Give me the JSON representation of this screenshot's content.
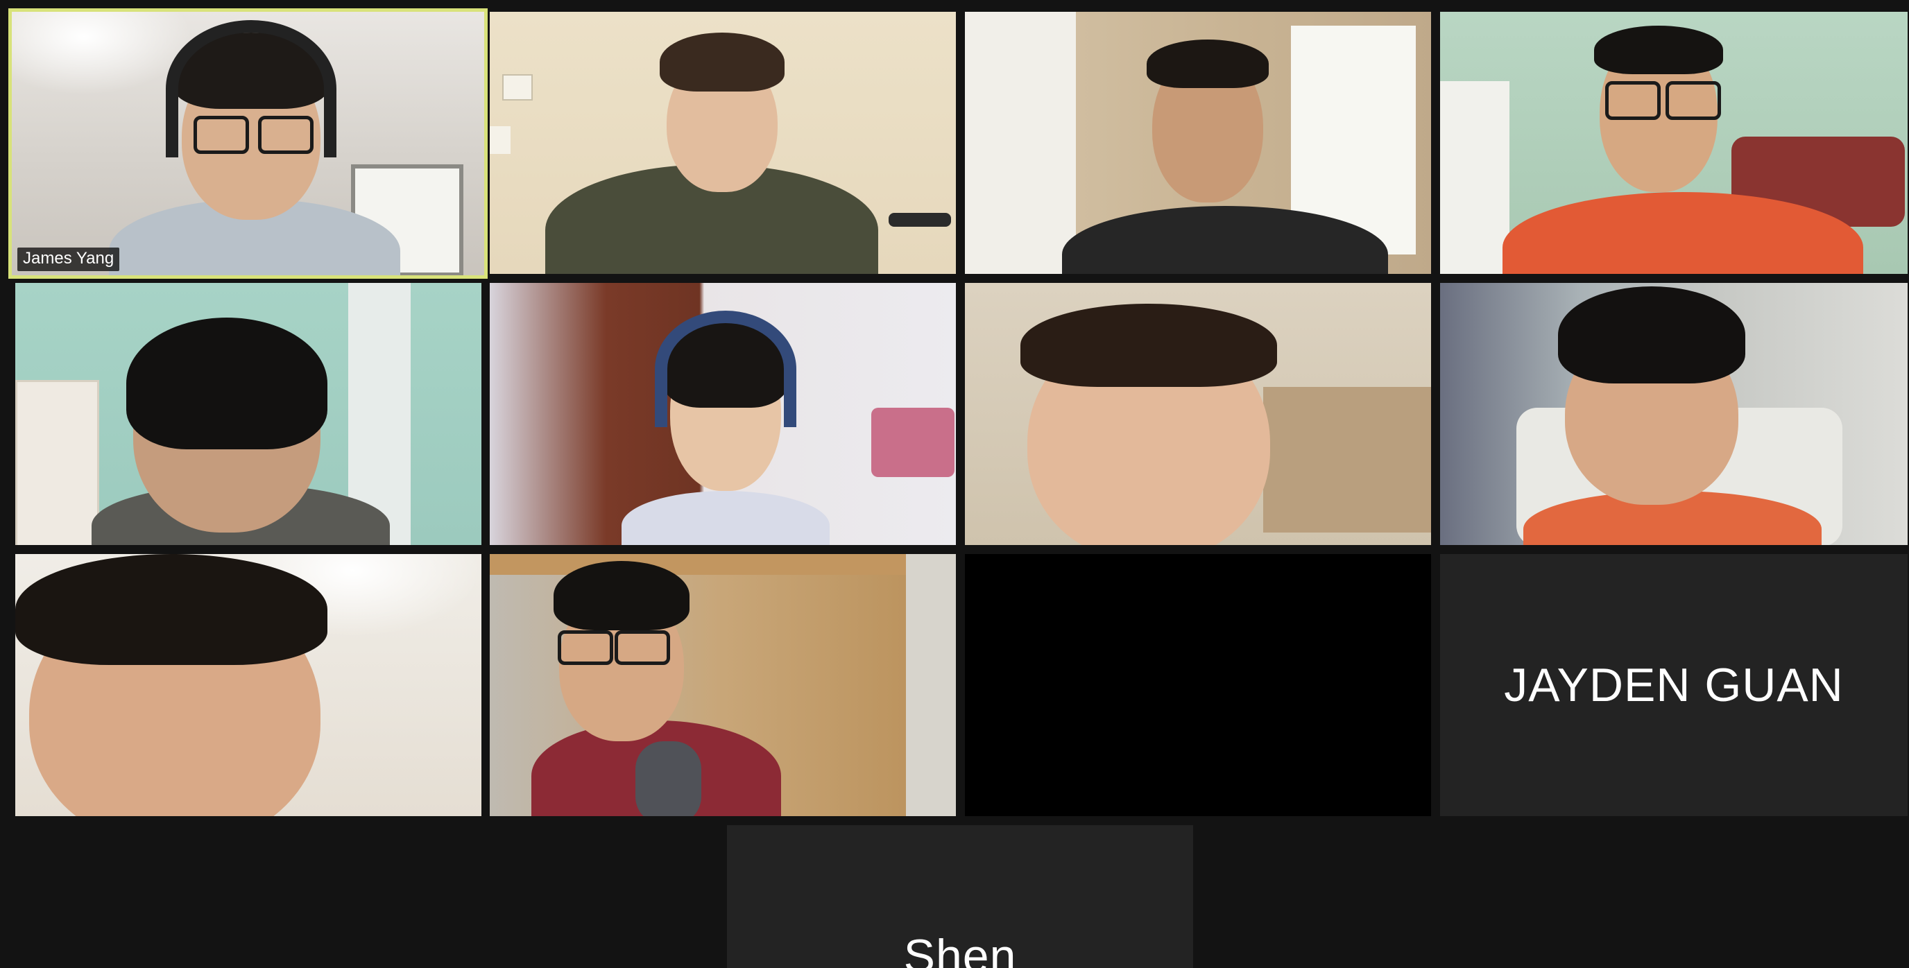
{
  "participants": [
    {
      "name": "James Yang",
      "show_label": true,
      "active_speaker": true
    },
    {
      "name": "",
      "show_label": false
    },
    {
      "name": "",
      "show_label": false
    },
    {
      "name": "",
      "show_label": false
    },
    {
      "name": "",
      "show_label": false
    },
    {
      "name": "",
      "show_label": false
    },
    {
      "name": "",
      "show_label": false
    },
    {
      "name": "",
      "show_label": false
    },
    {
      "name": "",
      "show_label": false
    },
    {
      "name": "",
      "show_label": false
    },
    {
      "name": "",
      "show_label": false,
      "video_off_blank": true
    },
    {
      "name": "JAYDEN GUAN",
      "video_off": true
    },
    {
      "name": "Shen",
      "video_off": true
    }
  ],
  "colors": {
    "background": "#131313",
    "active_speaker_border": "#d8e27a",
    "video_off_tile": "#232323",
    "name_text": "#ffffff"
  }
}
